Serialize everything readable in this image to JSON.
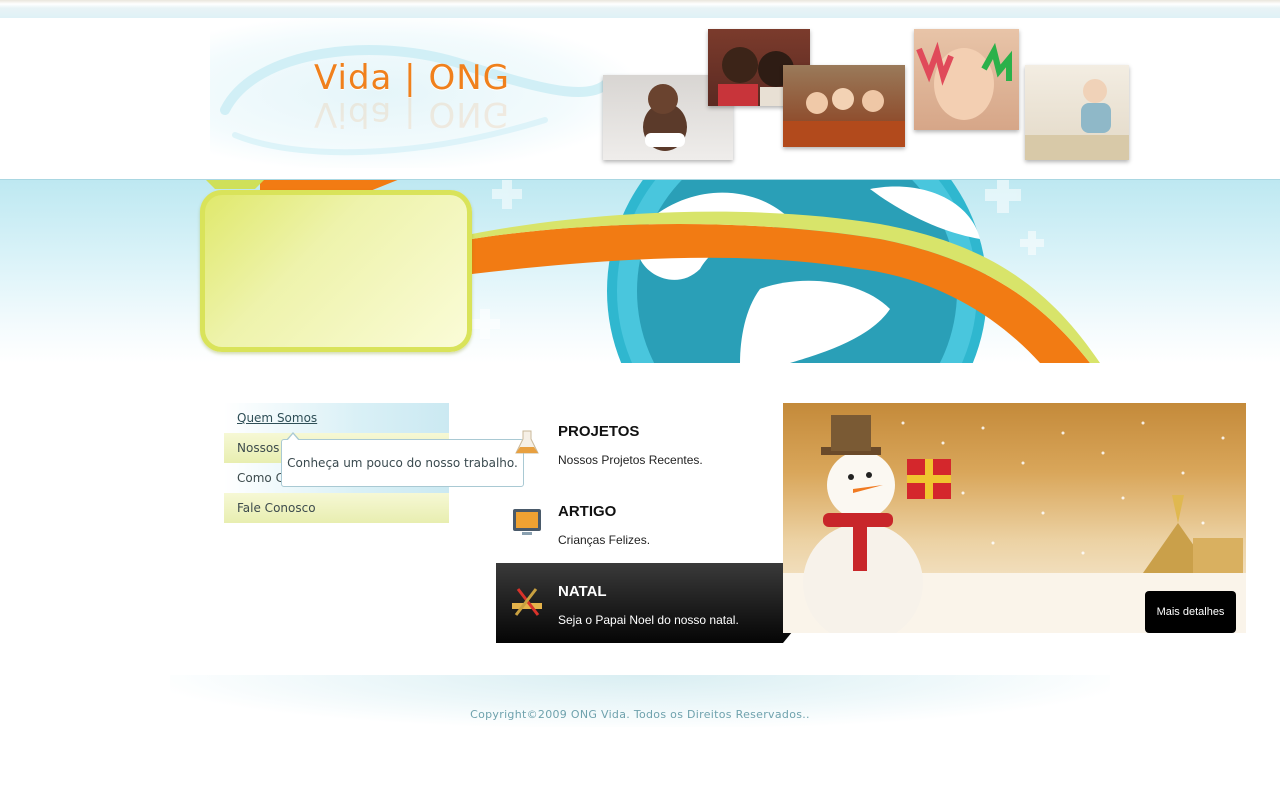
{
  "header": {
    "logo_text": "Vida | ONG"
  },
  "menu": {
    "items": [
      {
        "label": "Quem Somos"
      },
      {
        "label": "Nossos Projetos"
      },
      {
        "label": "Como Colaborar"
      },
      {
        "label": "Fale Conosco"
      }
    ],
    "tooltip": "Conheça um pouco do nosso trabalho."
  },
  "slider": {
    "tabs": [
      {
        "title": "PROJETOS",
        "subtitle": "Nossos Projetos Recentes.",
        "icon": "flask-icon"
      },
      {
        "title": "ARTIGO",
        "subtitle": "Crianças Felizes.",
        "icon": "monitor-icon"
      },
      {
        "title": "NATAL",
        "subtitle": "Seja o Papai Noel do nosso natal.",
        "icon": "tools-icon"
      }
    ],
    "active_index": 2,
    "more_button": "Mais detalhes"
  },
  "footer": {
    "copyright": "Copyright©2009 ONG Vida. Todos os Direitos Reservados.."
  },
  "colors": {
    "accent_orange": "#f0801c",
    "sky_blue": "#bde8f1",
    "lime": "#dfe868"
  }
}
